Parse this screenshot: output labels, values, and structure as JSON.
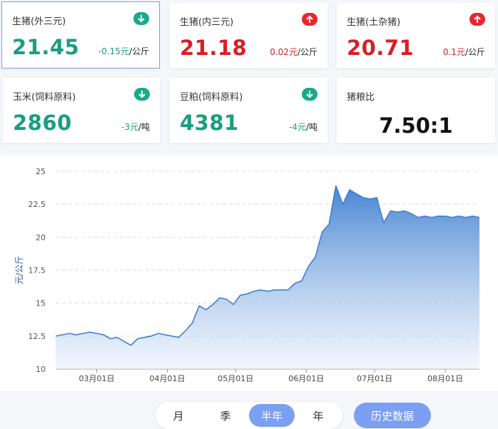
{
  "cards": [
    {
      "title": "生猪(外三元)",
      "value": "21.45",
      "change": "-0.15元",
      "unit": "/公斤",
      "trend": "down",
      "icon": "arrow-down-icon"
    },
    {
      "title": "生猪(内三元)",
      "value": "21.18",
      "change": "0.02元",
      "unit": "/公斤",
      "trend": "up",
      "icon": "arrow-up-icon"
    },
    {
      "title": "生猪(土杂猪)",
      "value": "20.71",
      "change": "0.1元",
      "unit": "/公斤",
      "trend": "up",
      "icon": "arrow-up-icon"
    },
    {
      "title": "玉米(饲料原料)",
      "value": "2860",
      "change": "-3元",
      "unit": "/吨",
      "trend": "down",
      "icon": "arrow-down-icon"
    },
    {
      "title": "豆粕(饲料原料)",
      "value": "4381",
      "change": "-4元",
      "unit": "/吨",
      "trend": "down",
      "icon": "arrow-down-icon"
    },
    {
      "title": "猪粮比",
      "value": "7.50:1"
    }
  ],
  "colors": {
    "down": "#1a9e80",
    "up": "#d81f26",
    "accent": "#7b9ff2",
    "line": "#3f7fd0"
  },
  "chart_data": {
    "type": "area",
    "ylabel": "元/公斤",
    "ylim": [
      10,
      25
    ],
    "yticks": [
      10,
      12.5,
      15,
      17.5,
      20,
      22.5,
      25
    ],
    "grid": true,
    "xticks": [
      "03月01日",
      "04月01日",
      "05月01日",
      "06月01日",
      "07月01日",
      "08月01日"
    ],
    "x": [
      "02-11",
      "02-14",
      "02-17",
      "02-20",
      "02-23",
      "02-26",
      "03-01",
      "03-04",
      "03-07",
      "03-10",
      "03-13",
      "03-16",
      "03-19",
      "03-22",
      "03-25",
      "03-28",
      "03-31",
      "04-03",
      "04-06",
      "04-09",
      "04-12",
      "04-15",
      "04-18",
      "04-21",
      "04-24",
      "04-27",
      "04-30",
      "05-03",
      "05-06",
      "05-09",
      "05-12",
      "05-15",
      "05-18",
      "05-21",
      "05-24",
      "05-27",
      "05-30",
      "06-02",
      "06-05",
      "06-08",
      "06-11",
      "06-14",
      "06-17",
      "06-20",
      "06-23",
      "06-26",
      "06-29",
      "07-02",
      "07-03",
      "07-05",
      "07-08",
      "07-11",
      "07-14",
      "07-17",
      "07-20",
      "07-23",
      "07-26",
      "07-29",
      "08-01",
      "08-04",
      "08-07",
      "08-10",
      "08-13",
      "08-16"
    ],
    "values": [
      12.5,
      12.6,
      12.7,
      12.6,
      12.7,
      12.8,
      12.7,
      12.6,
      12.3,
      12.4,
      12.1,
      11.8,
      12.3,
      12.4,
      12.5,
      12.7,
      12.6,
      12.5,
      12.4,
      12.9,
      13.5,
      14.8,
      14.5,
      14.9,
      15.4,
      15.3,
      14.9,
      15.6,
      15.7,
      15.9,
      16.0,
      15.9,
      16.0,
      16.0,
      16.0,
      16.5,
      16.7,
      17.8,
      18.5,
      20.4,
      21.0,
      23.9,
      22.5,
      23.6,
      23.3,
      23.0,
      22.9,
      23.0,
      22.3,
      21.1,
      22.0,
      21.9,
      22.0,
      21.8,
      21.5,
      21.6,
      21.5,
      21.6,
      21.6,
      21.5,
      21.6,
      21.5,
      21.6,
      21.5
    ],
    "series": [
      {
        "name": "",
        "values": []
      }
    ]
  },
  "tabs": {
    "items": [
      "月",
      "季",
      "半年",
      "年"
    ],
    "active": 2
  },
  "history_button": "历史数据"
}
